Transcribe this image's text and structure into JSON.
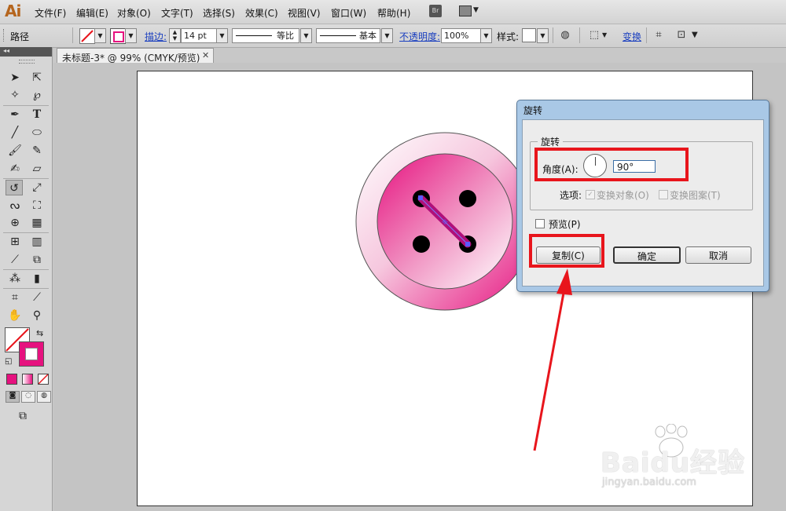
{
  "menubar": {
    "logo": "Ai",
    "items": [
      "文件(F)",
      "编辑(E)",
      "对象(O)",
      "文字(T)",
      "选择(S)",
      "效果(C)",
      "视图(V)",
      "窗口(W)",
      "帮助(H)"
    ],
    "bridge_label": "Br"
  },
  "controlbar": {
    "selection_type": "路径",
    "stroke_label": "描边:",
    "stroke_weight": "14 pt",
    "profile_ratio": "等比",
    "brush_basic": "基本",
    "opacity_label": "不透明度:",
    "opacity_value": "100%",
    "style_label": "样式:",
    "transform_label": "变换"
  },
  "document": {
    "tab_title": "未标题-3* @ 99% (CMYK/预览)",
    "zoom_percent": 99,
    "color_mode": "CMYK"
  },
  "dialog": {
    "title": "旋转",
    "group_title": "旋转",
    "angle_label": "角度(A):",
    "angle_value": "90°",
    "options_label": "选项:",
    "transform_objects": "变换对象(O)",
    "transform_patterns": "变换图案(T)",
    "preview_label": "预览(P)",
    "copy_button": "复制(C)",
    "ok_button": "确定",
    "cancel_button": "取消"
  },
  "watermark": {
    "brand": "Baidu经验",
    "url": "jingyan.baidu.com"
  },
  "colors": {
    "accent_pink": "#e6127f",
    "annotation_red": "#e8151c",
    "dialog_frame": "#a9c8e6"
  }
}
